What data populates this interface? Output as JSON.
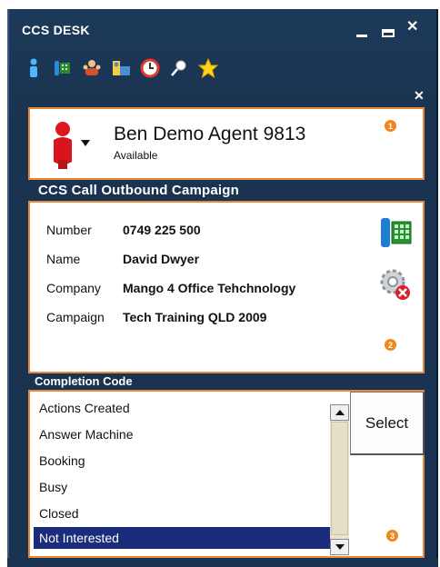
{
  "window": {
    "title": "CCS DESK",
    "controls": [
      "minimize",
      "maximize",
      "close"
    ]
  },
  "toolbar": {
    "icons": [
      "agent-icon",
      "phone-icon",
      "people-icon",
      "folder-user-icon",
      "clock-icon",
      "pin-icon",
      "star-icon"
    ]
  },
  "agent": {
    "name": "Ben Demo Agent 9813",
    "status": "Available",
    "badge": "1"
  },
  "campaign": {
    "section_title": "CCS Call Outbound Campaign",
    "badge": "2",
    "fields": [
      {
        "label": "Number",
        "value": "0749 225 500"
      },
      {
        "label": "Name",
        "value": "David Dwyer"
      },
      {
        "label": "Company",
        "value": "Mango 4 Office Tehchnology"
      },
      {
        "label": "Campaign",
        "value": "Tech Training QLD 2009"
      }
    ]
  },
  "completion": {
    "section_title": "Completion Code",
    "badge": "3",
    "select_label": "Select",
    "items": [
      "Actions Created",
      "Answer Machine",
      "Booking",
      "Busy",
      "Closed",
      "Not Interested"
    ],
    "selected": "Not Interested"
  },
  "colors": {
    "window_bg": "#1a3350",
    "panel_border": "#e8883a",
    "badge": "#f0861e",
    "selection": "#1a2c7a"
  }
}
